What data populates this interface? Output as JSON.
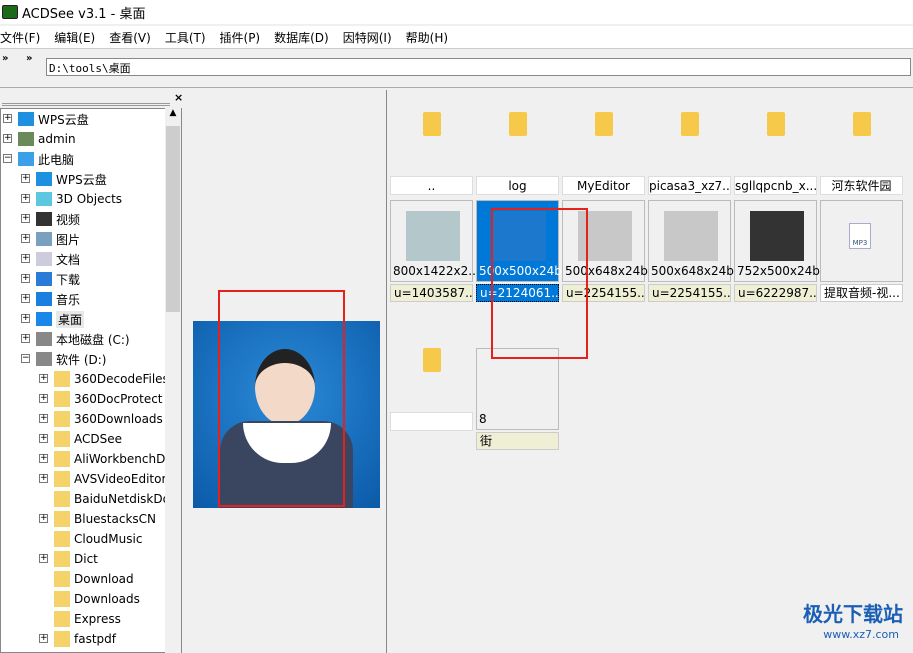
{
  "app": {
    "title": "ACDSee v3.1 - 桌面"
  },
  "menu": [
    "文件(F)",
    "编辑(E)",
    "查看(V)",
    "工具(T)",
    "插件(P)",
    "数据库(D)",
    "因特网(I)",
    "帮助(H)"
  ],
  "toolbar": {
    "chevron": "»",
    "address": "D:\\tools\\桌面"
  },
  "panels": {
    "close": "×"
  },
  "tree": [
    {
      "label": "WPS云盘",
      "level": 0,
      "exp": "+",
      "icon": "cloud-icon"
    },
    {
      "label": "admin",
      "level": 0,
      "exp": "+",
      "icon": "user-icon"
    },
    {
      "label": "此电脑",
      "level": 0,
      "exp": "−",
      "icon": "computer-icon"
    },
    {
      "label": "WPS云盘",
      "level": 1,
      "exp": "+",
      "icon": "cloud-icon"
    },
    {
      "label": "3D Objects",
      "level": 1,
      "exp": "+",
      "icon": "cube-icon"
    },
    {
      "label": "视频",
      "level": 1,
      "exp": "+",
      "icon": "video-icon"
    },
    {
      "label": "图片",
      "level": 1,
      "exp": "+",
      "icon": "picture-icon"
    },
    {
      "label": "文档",
      "level": 1,
      "exp": "+",
      "icon": "document-icon"
    },
    {
      "label": "下载",
      "level": 1,
      "exp": "+",
      "icon": "download-icon"
    },
    {
      "label": "音乐",
      "level": 1,
      "exp": "+",
      "icon": "music-icon"
    },
    {
      "label": "桌面",
      "level": 1,
      "exp": "+",
      "icon": "desktop-icon",
      "selected": true
    },
    {
      "label": "本地磁盘 (C:)",
      "level": 1,
      "exp": "+",
      "icon": "drive-icon"
    },
    {
      "label": "软件 (D:)",
      "level": 1,
      "exp": "−",
      "icon": "drive-icon"
    },
    {
      "label": "360DecodeFiles",
      "level": 2,
      "exp": "+",
      "icon": "folder-icon"
    },
    {
      "label": "360DocProtect",
      "level": 2,
      "exp": "+",
      "icon": "folder-icon"
    },
    {
      "label": "360Downloads",
      "level": 2,
      "exp": "+",
      "icon": "folder-icon"
    },
    {
      "label": "ACDSee",
      "level": 2,
      "exp": "+",
      "icon": "folder-icon"
    },
    {
      "label": "AliWorkbenchD",
      "level": 2,
      "exp": "+",
      "icon": "folder-icon"
    },
    {
      "label": "AVSVideoEditor",
      "level": 2,
      "exp": "+",
      "icon": "folder-icon"
    },
    {
      "label": "BaiduNetdiskDo",
      "level": 2,
      "exp": "",
      "icon": "folder-icon"
    },
    {
      "label": "BluestacksCN",
      "level": 2,
      "exp": "+",
      "icon": "folder-icon"
    },
    {
      "label": "CloudMusic",
      "level": 2,
      "exp": "",
      "icon": "folder-icon"
    },
    {
      "label": "Dict",
      "level": 2,
      "exp": "+",
      "icon": "folder-icon"
    },
    {
      "label": "Download",
      "level": 2,
      "exp": "",
      "icon": "folder-icon"
    },
    {
      "label": "Downloads",
      "level": 2,
      "exp": "",
      "icon": "folder-icon"
    },
    {
      "label": "Express",
      "level": 2,
      "exp": "",
      "icon": "folder-icon"
    },
    {
      "label": "fastpdf",
      "level": 2,
      "exp": "+",
      "icon": "folder-icon"
    }
  ],
  "folders": [
    "..",
    "log",
    "MyEditor",
    "picasa3_xz7....",
    "sgllqpcnb_x...",
    "河东软件园",
    ""
  ],
  "files": [
    {
      "dims": "800x1422x2...",
      "name": "u=1403587...",
      "thumb": "#b4c8cc"
    },
    {
      "dims": "500x500x24b",
      "name": "u=2124061...",
      "thumb": "#1c78cc",
      "selected": true
    },
    {
      "dims": "500x648x24b",
      "name": "u=2254155...",
      "thumb": "#c8c8c8"
    },
    {
      "dims": "500x648x24b",
      "name": "u=2254155...",
      "thumb": "#c8c8c8"
    },
    {
      "dims": "752x500x24b",
      "name": "u=6222987...",
      "thumb": "#333333"
    },
    {
      "dims": "",
      "name": "提取音频-视...",
      "thumb": "mp3"
    },
    {
      "dims": "8",
      "name": "街",
      "thumb": ""
    }
  ],
  "mp3_label": "MP3",
  "watermark": {
    "text": "极光下载站",
    "url": "www.xz7.com"
  },
  "colors": {
    "selection": "#0078d7",
    "highlight_box": "#e8201c",
    "folder": "#f6c94a"
  }
}
